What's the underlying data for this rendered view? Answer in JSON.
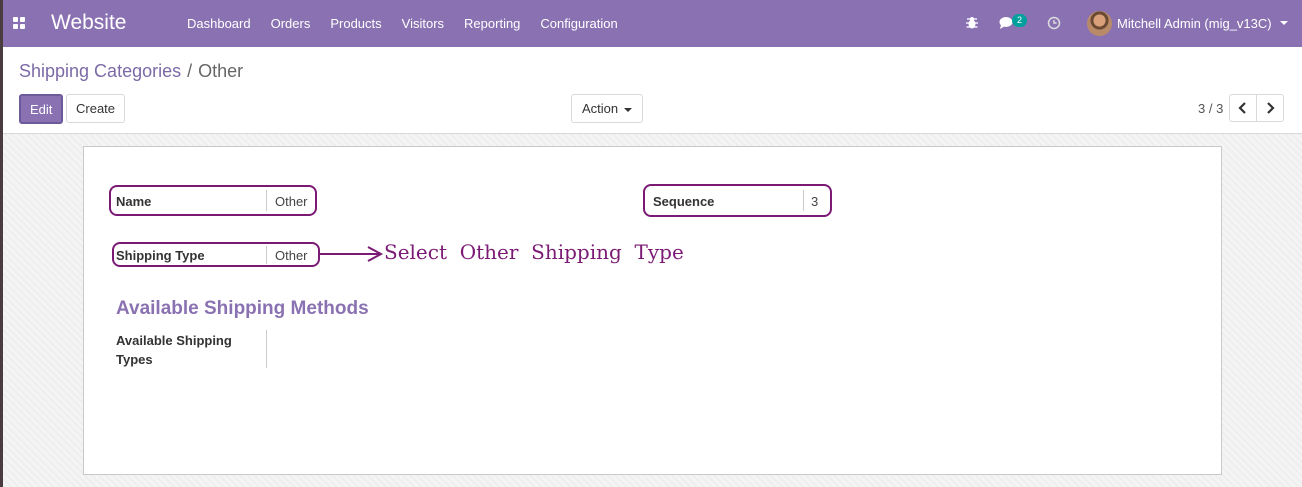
{
  "navbar": {
    "brand": "Website",
    "menu": [
      "Dashboard",
      "Orders",
      "Products",
      "Visitors",
      "Reporting",
      "Configuration"
    ],
    "chat_badge": "2",
    "user": "Mitchell Admin (mig_v13C)",
    "color": "#8a72b2"
  },
  "breadcrumb": {
    "parent": "Shipping Categories",
    "separator": "/",
    "current": "Other"
  },
  "toolbar": {
    "edit": "Edit",
    "create": "Create",
    "action": "Action"
  },
  "pager": {
    "label": "3 / 3"
  },
  "form": {
    "name_label": "Name",
    "name_value": "Other",
    "sequence_label": "Sequence",
    "sequence_value": "3",
    "shipping_type_label": "Shipping Type",
    "shipping_type_value": "Other",
    "section_title": "Available Shipping Methods",
    "available_types_label_line1": "Available Shipping",
    "available_types_label_line2": "Types",
    "available_types_value": ""
  },
  "annotation": {
    "text": "Select  Other  Shipping  Type",
    "color": "#7b1a74"
  }
}
